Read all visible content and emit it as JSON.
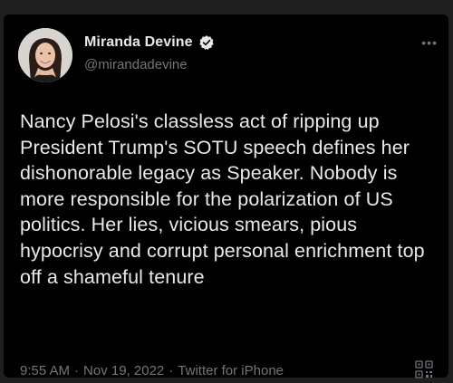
{
  "tweet": {
    "author": {
      "display_name": "Miranda Devine",
      "handle": "@mirandadevine",
      "verified": true
    },
    "more_label": "•••",
    "text": "Nancy Pelosi's classless act of ripping up President Trump's SOTU speech defines her dishonorable legacy as Speaker. Nobody is more responsible for the polarization of US politics. Her lies, vicious smears, pious hypocrisy and corrupt personal enrichment top off a shameful tenure",
    "time": "9:55 AM",
    "date": "Nov 19, 2022",
    "source": "Twitter for iPhone",
    "separator": "·"
  },
  "icons": {
    "verified": "verified-badge-icon",
    "more": "more-options-icon",
    "corner": "qr-code-icon"
  },
  "colors": {
    "background": "#000000",
    "text": "#e7e9ea",
    "muted": "#71767b",
    "verified_badge": "#e7e9ea"
  }
}
